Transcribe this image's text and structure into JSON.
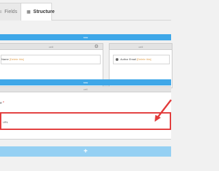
{
  "tabs": {
    "fields_label": "Fields",
    "structure_label": "Structure"
  },
  "sections": {
    "first_bar_label": "row",
    "second_bar_label": "row"
  },
  "cells": {
    "left_header": "cell",
    "right_header": "cell",
    "left_field_label": "Name",
    "left_field_delete": "[Delete this]",
    "right_field_label": "Author Email",
    "right_field_delete": "[Delete this]"
  },
  "row2": {
    "header": "cell",
    "required_field_label": "e",
    "required_mark": "*",
    "boxed_field_label": "URL"
  },
  "add_button_label": "+",
  "colors": {
    "accent": "#3ea7e8",
    "add_bar": "#95d0f3",
    "highlight": "#e23b3b",
    "delete_link": "#e0a050"
  }
}
